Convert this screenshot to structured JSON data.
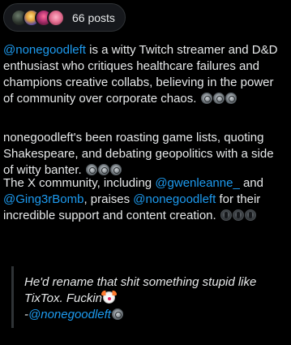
{
  "summary_header": {
    "posts_label": "66 posts",
    "avatars": [
      "avatar-1",
      "avatar-2",
      "avatar-3",
      "avatar-4"
    ]
  },
  "paragraph1": {
    "mention": "@nonegoodleft",
    "text_line1": " is a witty Twitch streamer and D&D",
    "text_line2": "enthusiast who critiques healthcare failures and",
    "text_line3": "champions creative collabs, believing in the power",
    "text_line4": "of community over corporate chaos."
  },
  "paragraph2": {
    "text_line1": "nonegoodleft's been roasting game lists, quoting",
    "text_line2": "Shakespeare, and debating geopolitics with a side",
    "text_line3": "of witty banter."
  },
  "paragraph3": {
    "text_line1a": "The X community, including ",
    "mention1": "@gwenleanne_",
    "text_line1b": " and",
    "mention2": "@Ging3rBomb",
    "text_line2a": ", praises ",
    "mention3": "@nonegoodleft",
    "text_line2b": " for their",
    "text_line3": "incredible support and content creation."
  },
  "quote": {
    "line1": "He'd rename that shit something stupid like",
    "line2": "TixTox. Fuckin",
    "attribution_dash": "-",
    "attribution_mention": "@nonegoodleft"
  },
  "colors": {
    "background": "#000000",
    "text": "#e7e9ea",
    "mention": "#1d9bf0",
    "quote_bar": "#2f3336"
  }
}
